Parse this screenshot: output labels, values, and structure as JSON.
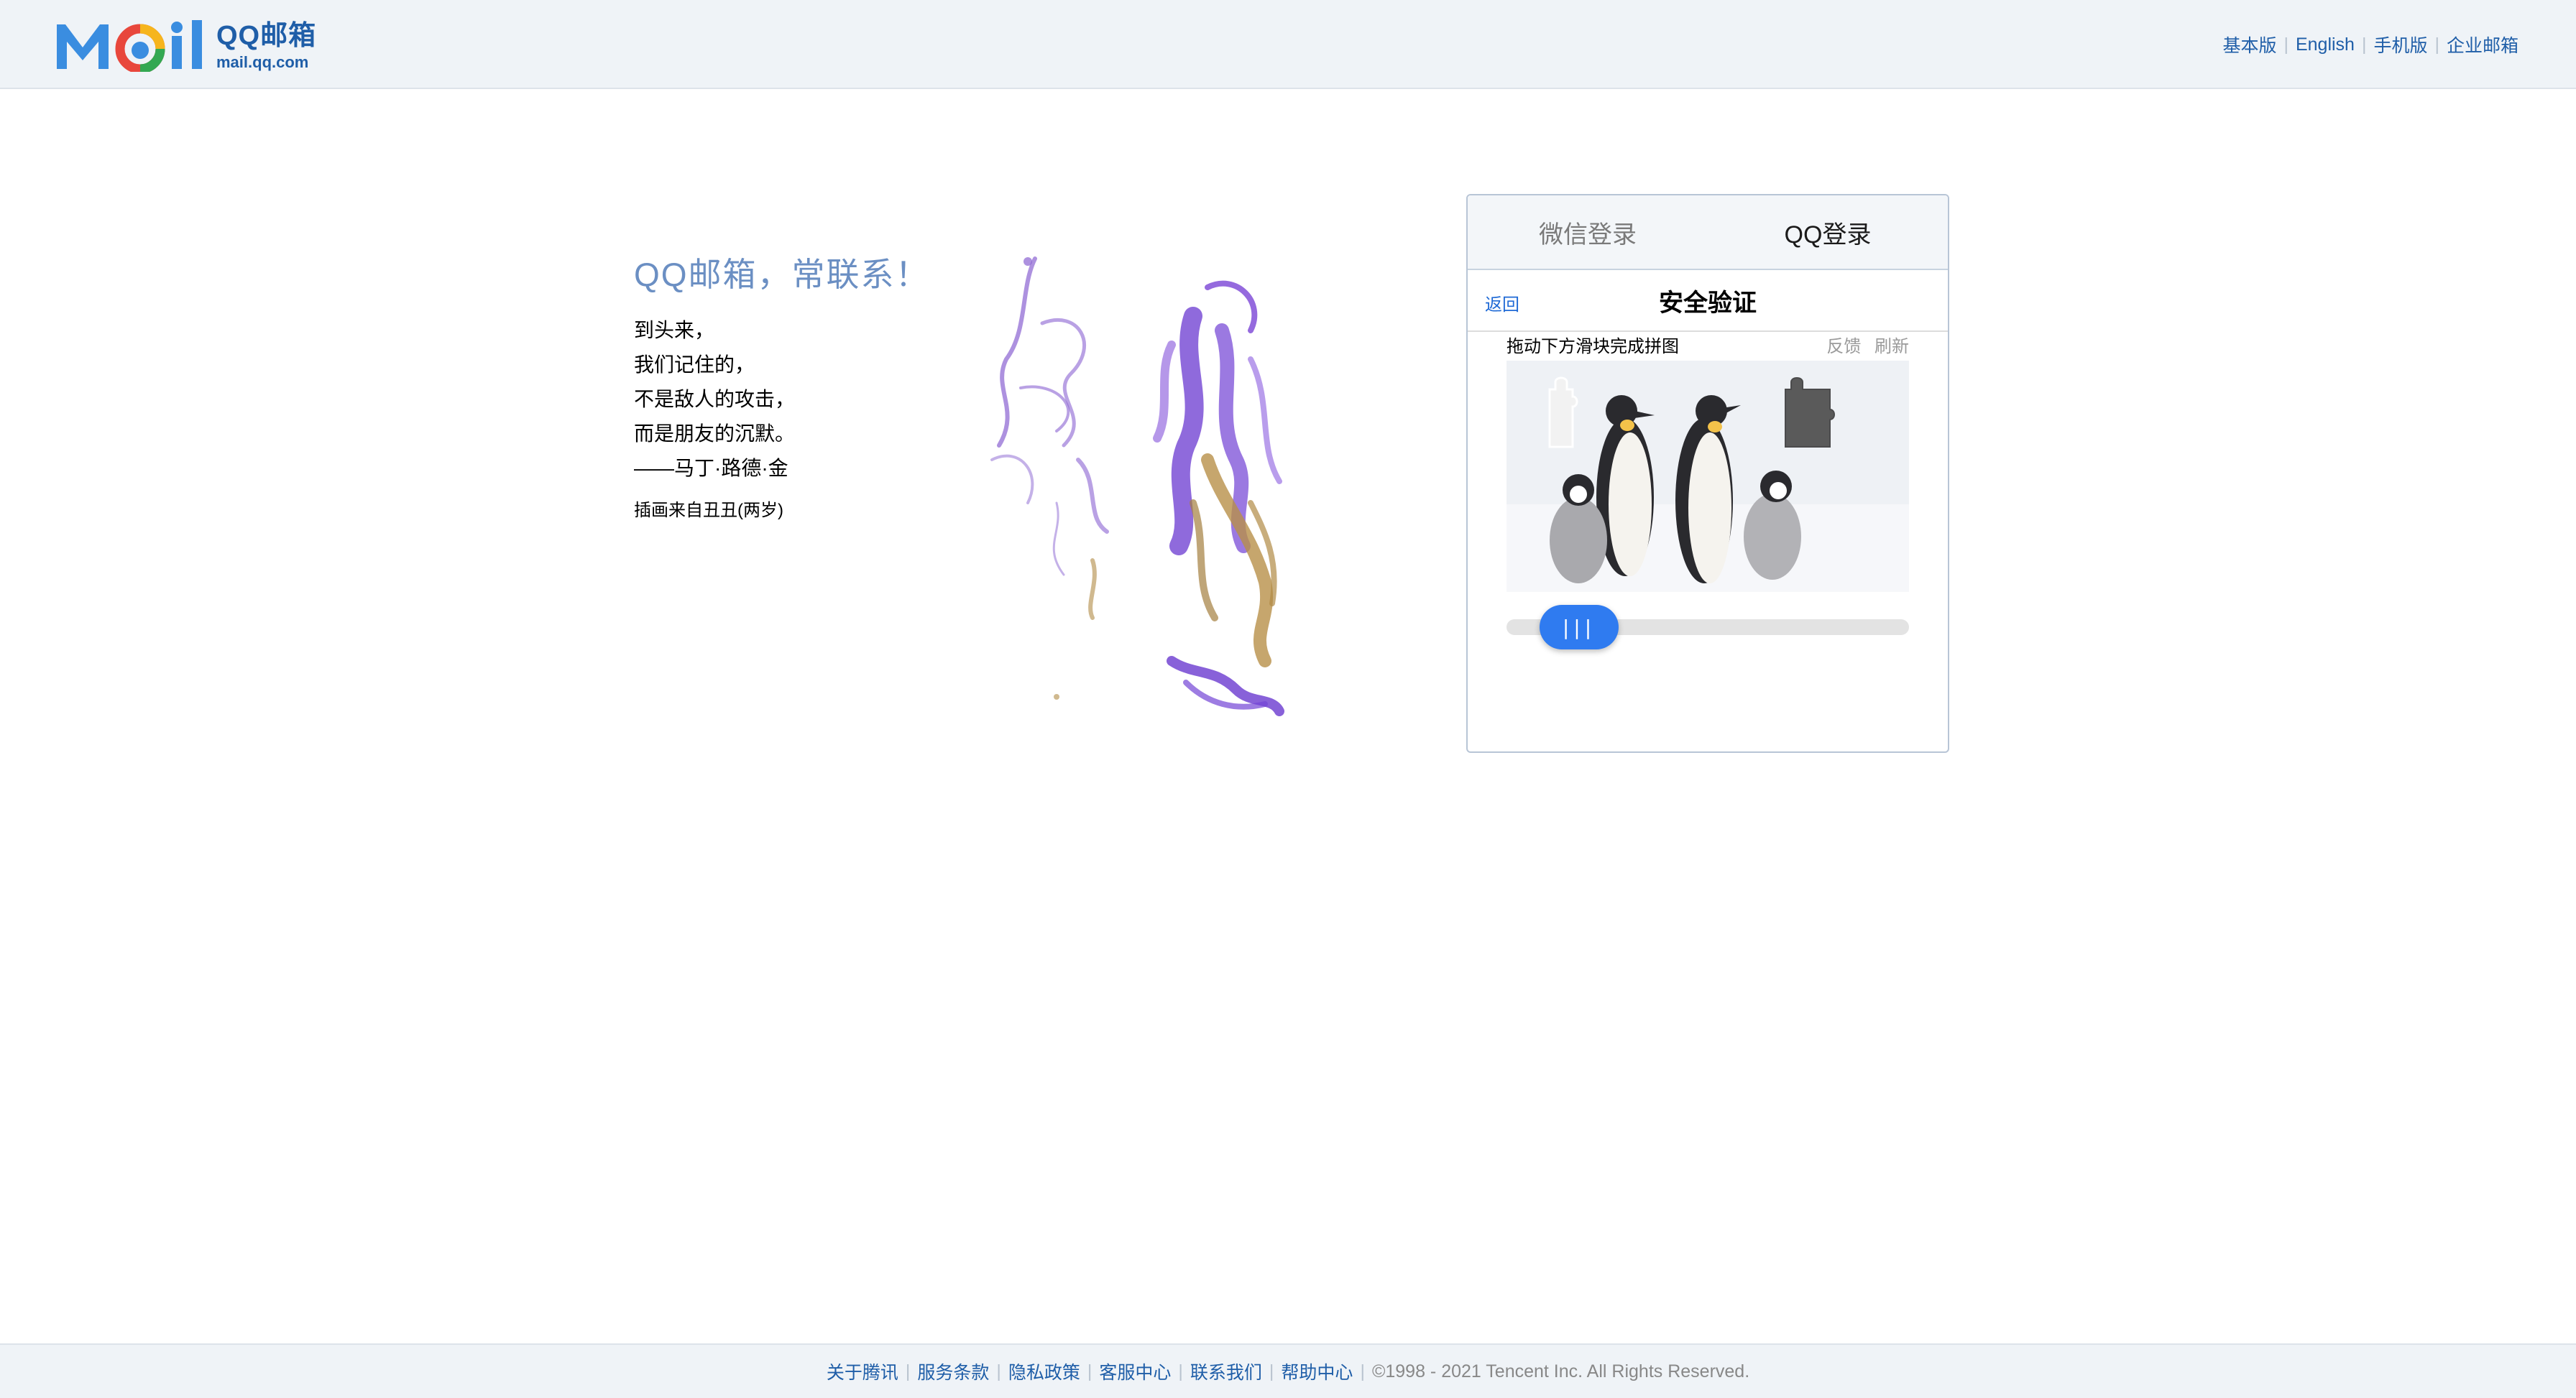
{
  "header": {
    "logo_title": "QQ邮箱",
    "logo_sub": "mail.qq.com",
    "links": [
      "基本版",
      "English",
      "手机版",
      "企业邮箱"
    ]
  },
  "main": {
    "slogan": "QQ邮箱，常联系！",
    "poem": [
      "到头来，",
      "我们记住的，",
      "不是敌人的攻击，",
      "而是朋友的沉默。",
      "——马丁·路德·金"
    ],
    "credit": "插画来自丑丑(两岁)"
  },
  "panel": {
    "tabs": [
      {
        "label": "微信登录",
        "active": false
      },
      {
        "label": "QQ登录",
        "active": true
      }
    ],
    "back": "返回",
    "title": "安全验证",
    "instruction": "拖动下方滑块完成拼图",
    "feedback": "反馈",
    "refresh": "刷新",
    "slider_handle": "|||"
  },
  "footer": {
    "links": [
      "关于腾讯",
      "服务条款",
      "隐私政策",
      "客服中心",
      "联系我们",
      "帮助中心"
    ],
    "copyright": "©1998 - 2021 Tencent Inc. All Rights Reserved."
  },
  "colors": {
    "accent": "#2f7bf0",
    "link": "#1f5ea8",
    "slogan": "#6b8fc3"
  }
}
